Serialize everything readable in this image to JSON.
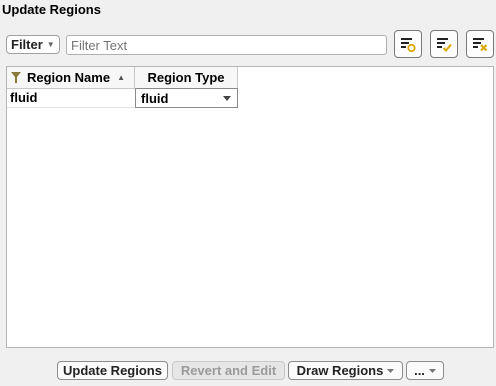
{
  "panel": {
    "title": "Update Regions"
  },
  "filter": {
    "dropdown_label": "Filter",
    "placeholder": "Filter Text"
  },
  "toolbar": {
    "icons": [
      "filter-settings-icon",
      "select-all-icon",
      "deselect-all-icon"
    ]
  },
  "table": {
    "columns": [
      "Region Name",
      "Region Type"
    ],
    "rows": [
      {
        "name": "fluid",
        "type": "fluid"
      }
    ]
  },
  "buttons": {
    "update": "Update Regions",
    "revert": "Revert and Edit",
    "draw": "Draw Regions",
    "more": "..."
  },
  "colors": {
    "accent_yellow": "#d8a800",
    "disabled_text": "#9a9a9a"
  }
}
